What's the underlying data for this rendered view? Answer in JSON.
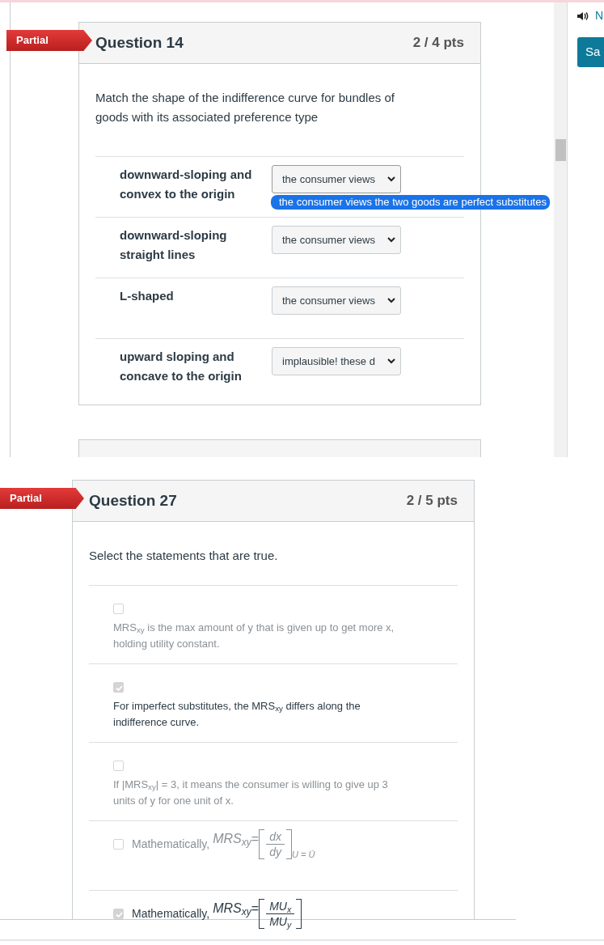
{
  "top_panel": {
    "question": {
      "status": "Partial",
      "title": "Question 14",
      "points": "2 / 4 pts",
      "prompt": "Match the shape of the indifference curve for bundles of goods with its associated preference type",
      "matches": [
        {
          "label": "downward-sloping and convex to the origin",
          "answer": "the consumer views",
          "open": true,
          "highlighted_option": "the consumer views the two goods are perfect substitutes"
        },
        {
          "label": "downward-sloping straight lines",
          "answer": "the consumer views",
          "open": false
        },
        {
          "label": "L-shaped",
          "answer": "the consumer views",
          "open": false
        },
        {
          "label": "upward sloping and concave to the origin",
          "answer": "implausible! these d",
          "open": false
        }
      ]
    }
  },
  "sidebar": {
    "audio_link": "N",
    "button": "Sa"
  },
  "bottom_panel": {
    "question": {
      "status": "Partial",
      "title": "Question 27",
      "points": "2 / 5 pts",
      "prompt": "Select the statements that are true.",
      "options": [
        {
          "kind": "text",
          "checked": false,
          "text": "MRS$_{xy}$ is the max amount of y that is given up to get more x, holding utility constant."
        },
        {
          "kind": "text",
          "checked": true,
          "text": "For imperfect substitutes, the MRS$_{xy}$ differs along the indifference curve."
        },
        {
          "kind": "text",
          "checked": false,
          "text": "If |MRS$_{xy}$| = 3, it means the consumer is willing to give up 3 units of y for one unit of x."
        },
        {
          "kind": "formula",
          "checked": false,
          "prefix": "Mathematically,",
          "lhs": "MRS$_{xy}$",
          "relation": "=",
          "numerator": "dx",
          "denominator": "dy",
          "condition": "U = Ū"
        },
        {
          "kind": "formula",
          "checked": true,
          "prefix": "Mathematically,",
          "lhs": "MRS$_{xy}$",
          "relation": "=",
          "numerator": "MU$_{x}$",
          "denominator": "MU$_{y}$"
        }
      ]
    }
  }
}
